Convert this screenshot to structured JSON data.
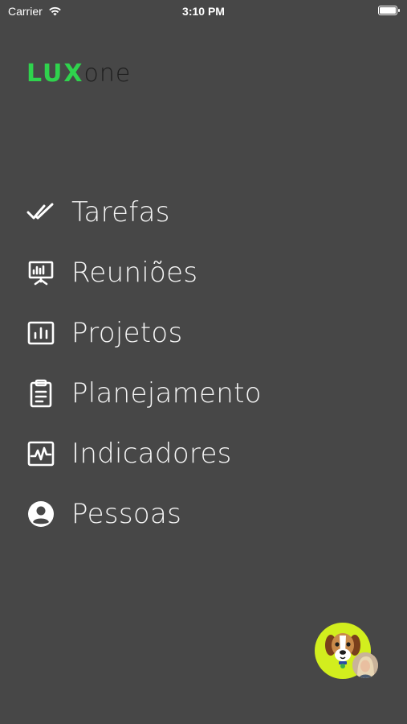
{
  "status_bar": {
    "carrier": "Carrier",
    "time": "3:10 PM"
  },
  "logo": {
    "part1": "LUX",
    "part2": "one",
    "brand_green": "#2fd34d"
  },
  "menu": {
    "items": [
      {
        "label": "Tarefas",
        "icon": "double-check-icon"
      },
      {
        "label": "Reuniões",
        "icon": "presentation-icon"
      },
      {
        "label": "Projetos",
        "icon": "bar-chart-icon"
      },
      {
        "label": "Planejamento",
        "icon": "clipboard-icon"
      },
      {
        "label": "Indicadores",
        "icon": "activity-chart-icon"
      },
      {
        "label": "Pessoas",
        "icon": "account-circle-icon"
      }
    ]
  },
  "fab": {
    "icon": "dog-avatar-icon",
    "accent": "#d2ee1e"
  },
  "colors": {
    "background": "#474747"
  }
}
